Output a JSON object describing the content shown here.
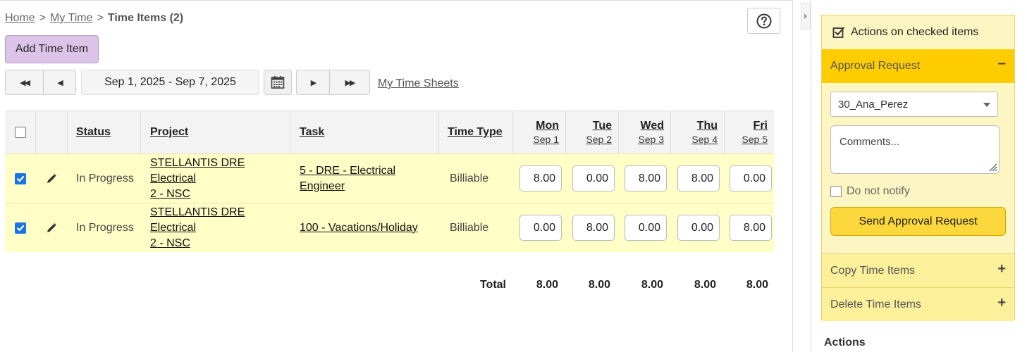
{
  "breadcrumb": {
    "home": "Home",
    "sep": ">",
    "my_time": "My Time",
    "current": "Time Items (2)"
  },
  "toolbar": {
    "add_label": "Add Time Item",
    "date_range": "Sep 1, 2025 - Sep 7, 2025",
    "sheets_link": "My Time Sheets",
    "nav_icons": [
      "rewind-icon",
      "prev-icon",
      "calendar-icon",
      "next-icon",
      "fast-forward-icon"
    ]
  },
  "table": {
    "headers": {
      "status": "Status",
      "project": "Project",
      "task": "Task",
      "time_type": "Time Type"
    },
    "days": [
      {
        "name": "Mon",
        "date": "Sep 1"
      },
      {
        "name": "Tue",
        "date": "Sep 2"
      },
      {
        "name": "Wed",
        "date": "Sep 3"
      },
      {
        "name": "Thu",
        "date": "Sep 4"
      },
      {
        "name": "Fri",
        "date": "Sep 5"
      }
    ],
    "rows": [
      {
        "checked": true,
        "status": "In Progress",
        "project_l1": "STELLANTIS DRE Electrical",
        "project_l2": "2 - NSC",
        "task_l1": "5 - DRE - Electrical",
        "task_l2": "Engineer",
        "time_type": "Billiable",
        "hours": [
          "8.00",
          "0.00",
          "8.00",
          "8.00",
          "0.00"
        ]
      },
      {
        "checked": true,
        "status": "In Progress",
        "project_l1": "STELLANTIS DRE Electrical",
        "project_l2": "2 - NSC",
        "task_l1": "100 - Vacations/Holiday",
        "task_l2": "",
        "time_type": "Billiable",
        "hours": [
          "0.00",
          "8.00",
          "0.00",
          "0.00",
          "8.00"
        ]
      }
    ],
    "total_label": "Total",
    "totals": [
      "8.00",
      "8.00",
      "8.00",
      "8.00",
      "8.00"
    ]
  },
  "panel": {
    "title": "Actions on checked items",
    "approval": {
      "title": "Approval Request",
      "toggle": "−",
      "approver": "30_Ana_Perez",
      "comments_placeholder": "Comments...",
      "notify_label": "Do not notify",
      "send_label": "Send Approval Request"
    },
    "copy": {
      "title": "Copy Time Items",
      "toggle": "+"
    },
    "delete": {
      "title": "Delete Time Items",
      "toggle": "+"
    },
    "actions_title": "Actions"
  },
  "colors": {
    "accent_yellow": "#ffcc00",
    "row_highlight": "#fefec6",
    "panel_bg": "#fdf6c3",
    "add_button": "#dcc3e8",
    "checkbox_blue": "#1a73e8"
  }
}
